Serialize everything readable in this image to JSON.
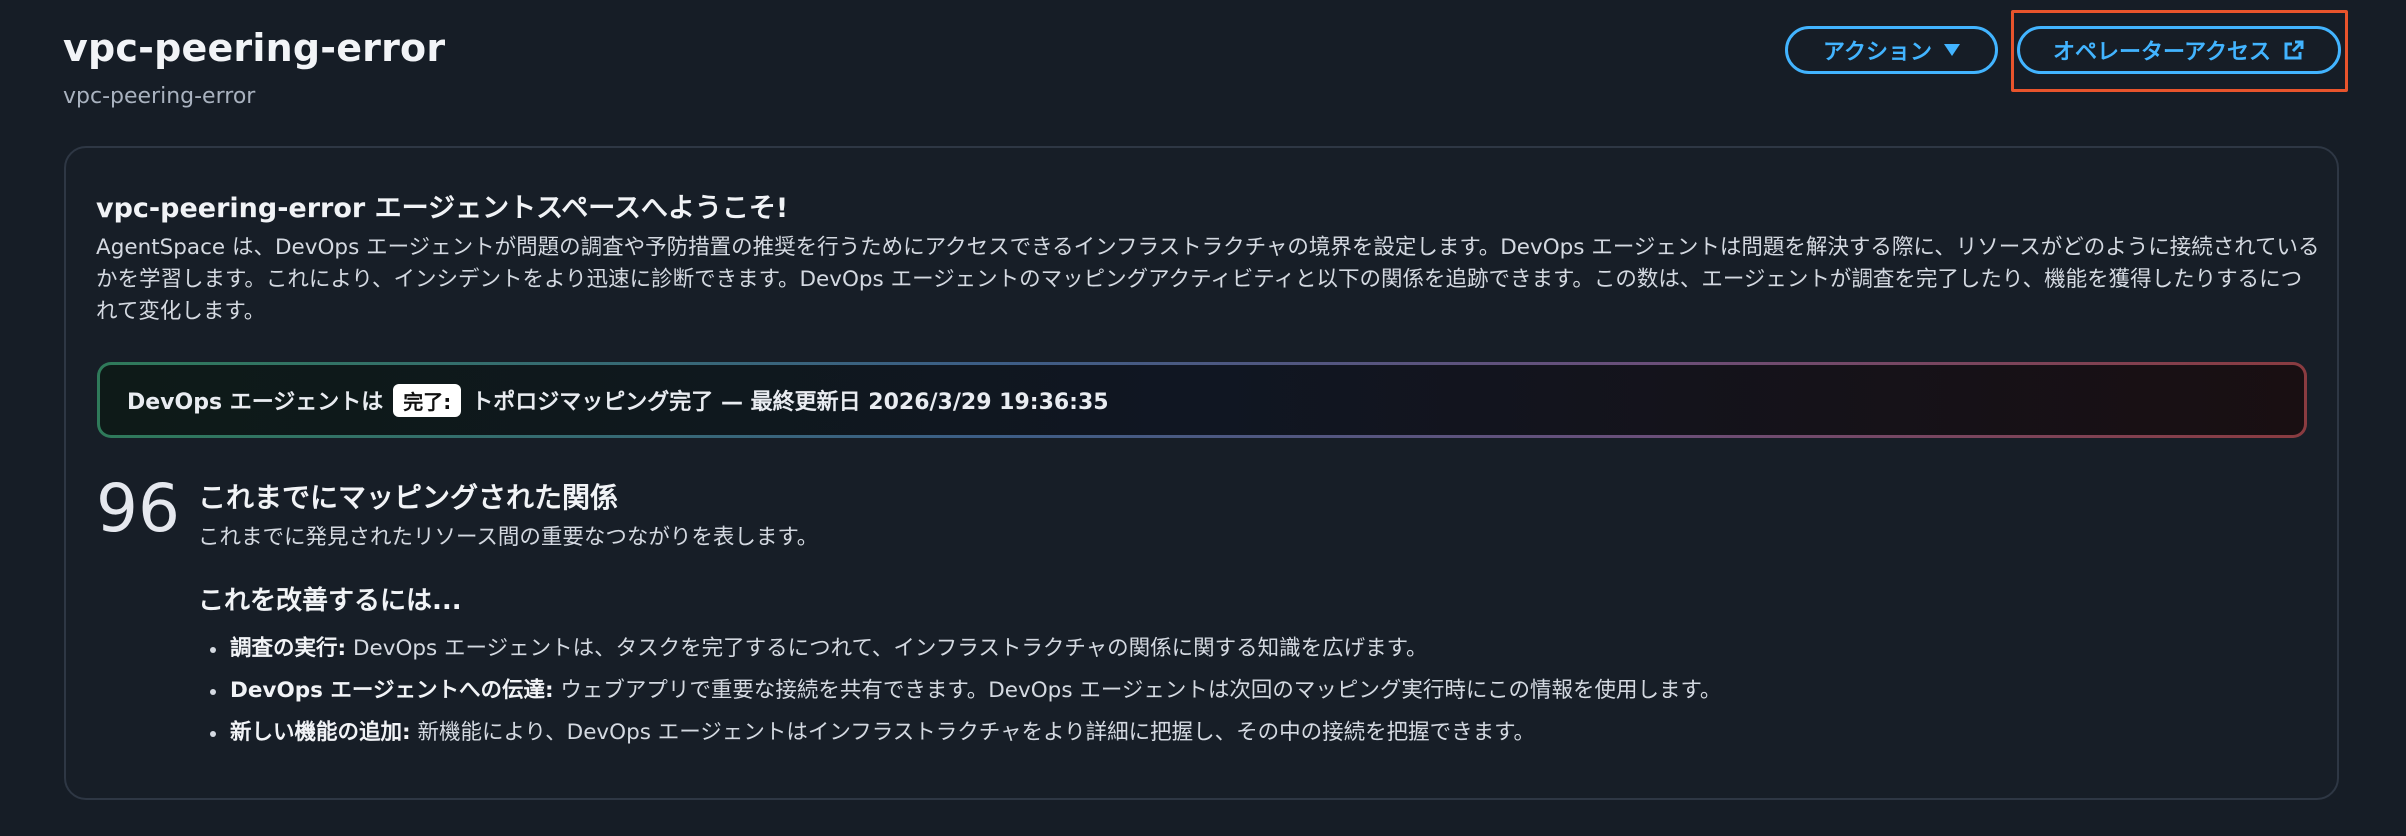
{
  "header": {
    "title": "vpc-peering-error",
    "subtitle": "vpc-peering-error",
    "actions_label": "アクション",
    "operator_access_label": "オペレーターアクセス"
  },
  "welcome": {
    "title": "vpc-peering-error エージェントスペースへようこそ!",
    "description": "AgentSpace は、DevOps エージェントが問題の調査や予防措置の推奨を行うためにアクセスできるインフラストラクチャの境界を設定します。DevOps エージェントは問題を解決する際に、リソースがどのように接続されているかを学習します。これにより、インシデントをより迅速に診断できます。DevOps エージェントのマッピングアクティビティと以下の関係を追跡できます。この数は、エージェントが調査を完了したり、機能を獲得したりするにつれて変化します。"
  },
  "status": {
    "prefix": "DevOps エージェントは",
    "badge": "完了:",
    "text": "トポロジマッピング完了 — 最終更新日 2026/3/29 19:36:35"
  },
  "metric": {
    "value": "96",
    "title": "これまでにマッピングされた関係",
    "subtitle": "これまでに発見されたリソース間の重要なつながりを表します。"
  },
  "improve": {
    "heading": "これを改善するには...",
    "items": [
      {
        "label": "調査の実行:",
        "text": " DevOps エージェントは、タスクを完了するにつれて、インフラストラクチャの関係に関する知識を広げます。"
      },
      {
        "label": "DevOps エージェントへの伝達:",
        "text": " ウェブアプリで重要な接続を共有できます。DevOps エージェントは次回のマッピング実行時にこの情報を使用します。"
      },
      {
        "label": "新しい機能の追加:",
        "text": " 新機能により、DevOps エージェントはインフラストラクチャをより詳細に把握し、その中の接続を把握できます。"
      }
    ]
  },
  "icons": {
    "actions_caret": "caret-down-icon",
    "operator_external": "external-link-icon"
  },
  "colors": {
    "background": "#161d26",
    "accent": "#42b4ff",
    "focus_ring": "#e8542c"
  }
}
